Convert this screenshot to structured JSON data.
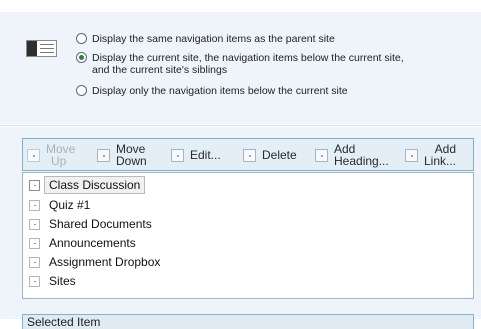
{
  "display_options": {
    "options": [
      {
        "label_lines": [
          "Display the same navigation items as the parent site"
        ],
        "checked": false
      },
      {
        "label_lines": [
          "Display the current site, the navigation items below the current site,",
          "and the current site's siblings"
        ],
        "checked": true
      },
      {
        "label_lines": [
          "Display only the navigation items below the current site"
        ],
        "checked": false
      }
    ]
  },
  "toolbar": {
    "move_up": [
      "Move",
      "Up"
    ],
    "move_down": [
      "Move",
      "Down"
    ],
    "edit": "Edit...",
    "delete": "Delete",
    "add_heading": [
      "Add",
      "Heading..."
    ],
    "add_link": [
      "Add",
      "Link..."
    ]
  },
  "nav_items": [
    {
      "label": "Class Discussion",
      "selected": true
    },
    {
      "label": "Quiz #1",
      "selected": false
    },
    {
      "label": "Shared Documents",
      "selected": false
    },
    {
      "label": "Announcements",
      "selected": false
    },
    {
      "label": "Assignment Dropbox",
      "selected": false
    },
    {
      "label": "Sites",
      "selected": false
    }
  ],
  "selected_item": {
    "header": "Selected Item"
  }
}
